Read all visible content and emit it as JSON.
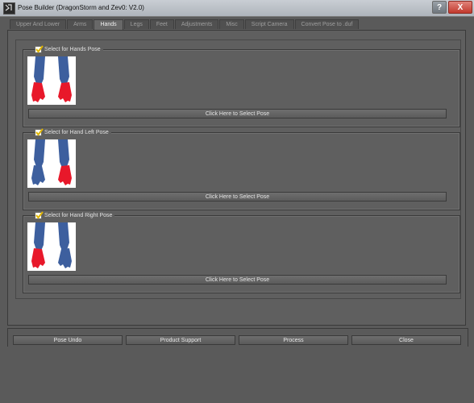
{
  "window": {
    "title": "Pose Builder (DragonStorm and Zev0: V2.0)",
    "help_label": "?",
    "close_label": "X"
  },
  "tabs": [
    {
      "label": "Upper And Lower"
    },
    {
      "label": "Arms"
    },
    {
      "label": "Hands",
      "active": true
    },
    {
      "label": "Legs"
    },
    {
      "label": "Feet"
    },
    {
      "label": "Adjustments"
    },
    {
      "label": "Misc"
    },
    {
      "label": "Script Camera"
    },
    {
      "label": "Convert Pose to .duf"
    }
  ],
  "groups": [
    {
      "checkbox_label": "Select for Hands Pose",
      "checked": true,
      "button_label": "Click Here to Select Pose",
      "highlight": "both"
    },
    {
      "checkbox_label": "Select for Hand Left Pose",
      "checked": true,
      "button_label": "Click Here to Select Pose",
      "highlight": "left"
    },
    {
      "checkbox_label": "Select for Hand Right Pose",
      "checked": true,
      "button_label": "Click Here to Select Pose",
      "highlight": "right"
    }
  ],
  "footer": {
    "pose_undo": "Pose Undo",
    "product_support": "Product Support",
    "process": "Process",
    "close": "Close"
  },
  "colors": {
    "highlight": "#e8182a",
    "arm": "#3d5f9e",
    "check": "#e0b500"
  }
}
